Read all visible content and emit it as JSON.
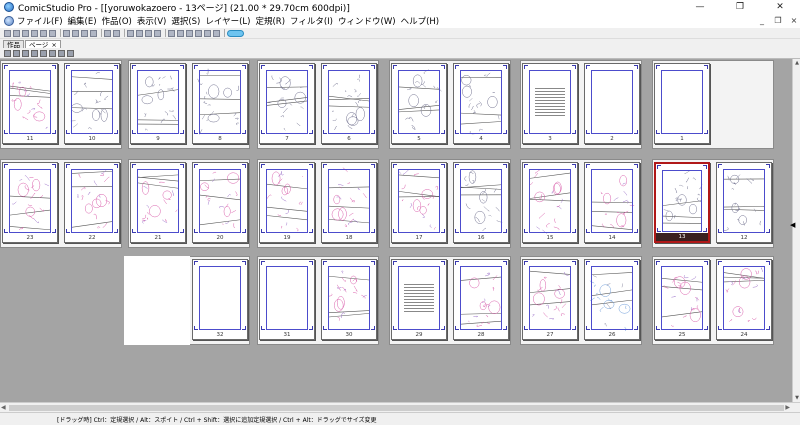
{
  "window": {
    "title": "ComicStudio Pro - [[yoruwokazoero - 13ページ] (21.00 * 29.70cm 600dpi)]",
    "controls": [
      "—",
      "❐",
      "✕"
    ]
  },
  "menu": {
    "items": [
      "ファイル(F)",
      "編集(E)",
      "作品(O)",
      "表示(V)",
      "選択(S)",
      "レイヤー(L)",
      "定規(R)",
      "フィルタ(I)",
      "ウィンドウ(W)",
      "ヘルプ(H)"
    ],
    "mdi_controls": [
      "_",
      "❐",
      "×"
    ]
  },
  "tabs": [
    {
      "label": "作品",
      "active": false
    },
    {
      "label": "ページ",
      "active": true,
      "close": "×"
    }
  ],
  "pages": [
    {
      "num": "11",
      "kind": "art",
      "pink": true
    },
    {
      "num": "10",
      "kind": "art",
      "pink": false
    },
    {
      "num": "9",
      "kind": "art",
      "pink": false
    },
    {
      "num": "8",
      "kind": "art",
      "pink": false
    },
    {
      "num": "7",
      "kind": "art",
      "pink": false
    },
    {
      "num": "6",
      "kind": "art",
      "pink": false
    },
    {
      "num": "5",
      "kind": "art",
      "pink": false
    },
    {
      "num": "4",
      "kind": "art",
      "pink": false
    },
    {
      "num": "3",
      "kind": "text"
    },
    {
      "num": "2",
      "kind": "blank"
    },
    {
      "num": "1",
      "kind": "blank"
    },
    {
      "num": "23",
      "kind": "art",
      "pink": true
    },
    {
      "num": "22",
      "kind": "art",
      "pink": true
    },
    {
      "num": "21",
      "kind": "art",
      "pink": true
    },
    {
      "num": "20",
      "kind": "art",
      "pink": true
    },
    {
      "num": "19",
      "kind": "art",
      "pink": true
    },
    {
      "num": "18",
      "kind": "art",
      "pink": true
    },
    {
      "num": "17",
      "kind": "art",
      "pink": true
    },
    {
      "num": "16",
      "kind": "art",
      "pink": false
    },
    {
      "num": "15",
      "kind": "art",
      "pink": true
    },
    {
      "num": "14",
      "kind": "art",
      "pink": true
    },
    {
      "num": "13",
      "kind": "art",
      "pink": false,
      "selected": true
    },
    {
      "num": "12",
      "kind": "art",
      "pink": false
    },
    {
      "num": "32",
      "kind": "blank"
    },
    {
      "num": "31",
      "kind": "blank"
    },
    {
      "num": "30",
      "kind": "art",
      "pink": true
    },
    {
      "num": "29",
      "kind": "text"
    },
    {
      "num": "28",
      "kind": "art",
      "pink": true
    },
    {
      "num": "27",
      "kind": "art",
      "pink": true
    },
    {
      "num": "26",
      "kind": "art",
      "pink": false,
      "blue": true
    },
    {
      "num": "25",
      "kind": "art",
      "pink": true
    },
    {
      "num": "24",
      "kind": "art",
      "pink": true
    }
  ],
  "statusbar": {
    "text": "[ドラッグ時] Ctrl：定規選択 / Alt：スポイト / Ctrl + Shift：選択に追加定規選択 / Ctrl + Alt：ドラッグでサイズ変更"
  }
}
